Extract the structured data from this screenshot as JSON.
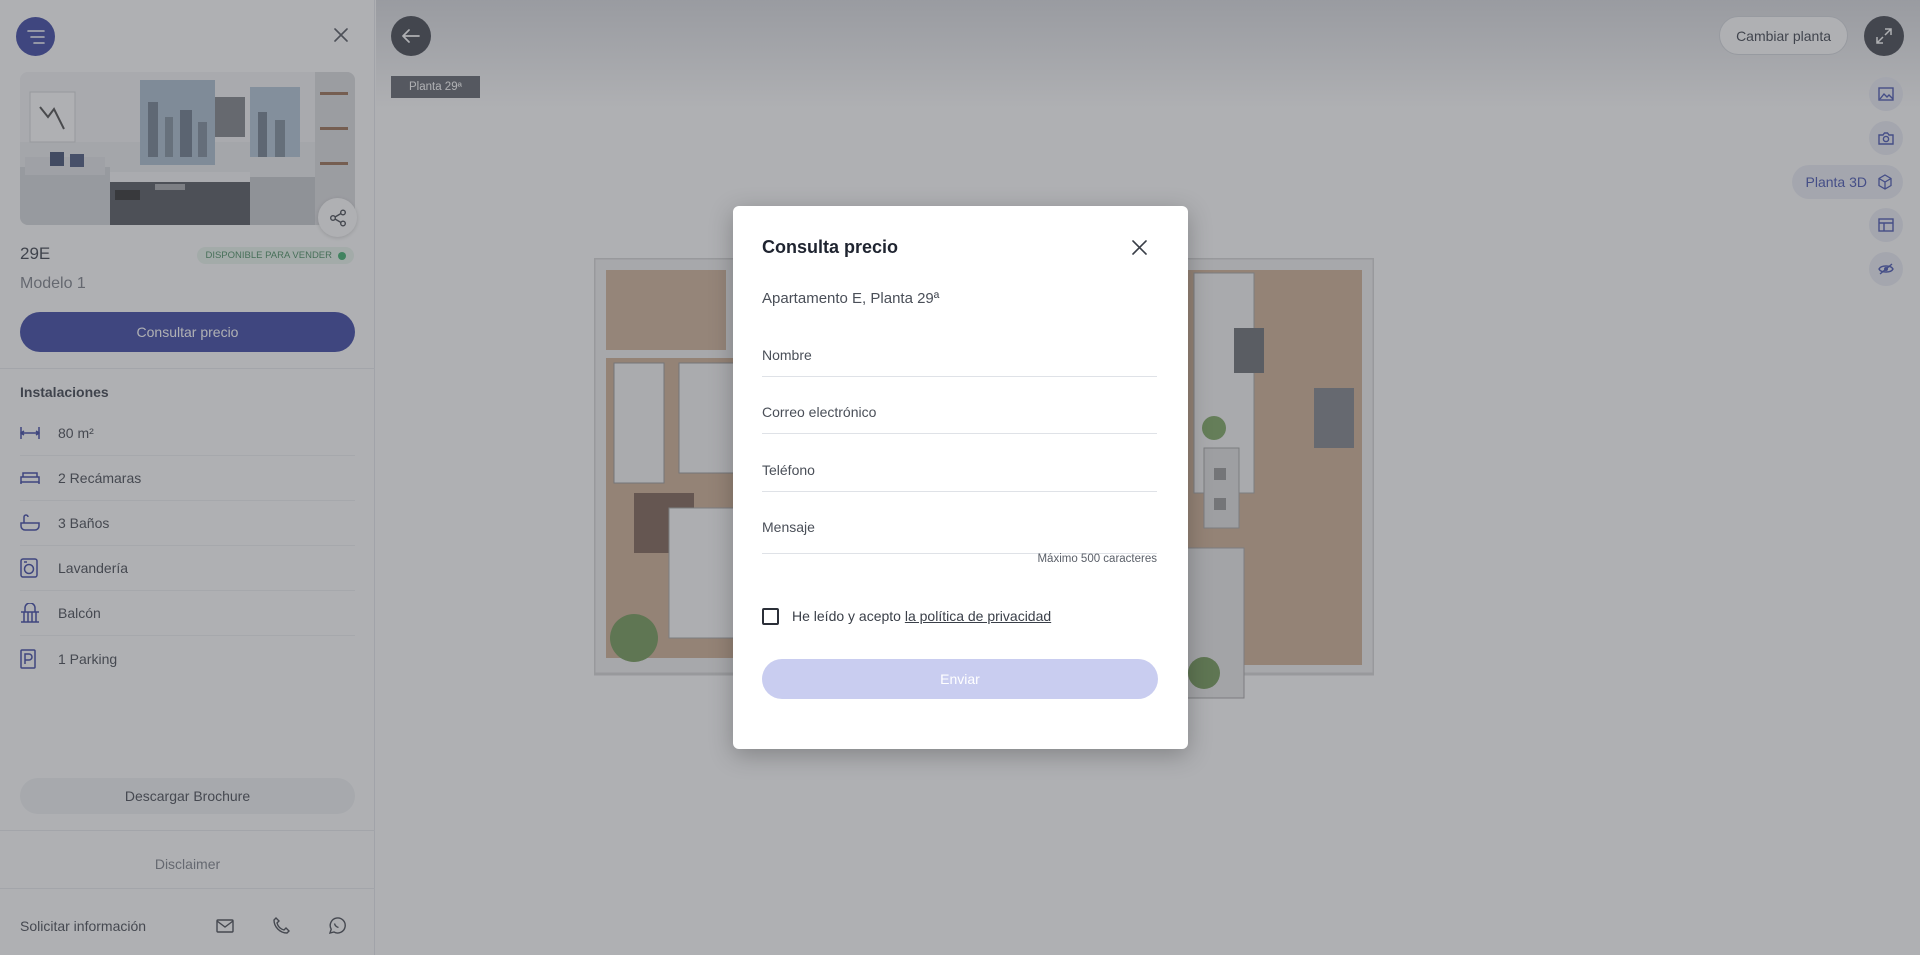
{
  "sidebar": {
    "unit_name": "29E",
    "status": "DISPONIBLE PARA VENDER",
    "model_name": "Modelo 1",
    "primary_button": "Consultar precio",
    "features_title": "Instalaciones",
    "features": [
      {
        "icon": "area-icon",
        "label": "80 m²"
      },
      {
        "icon": "bed-icon",
        "label": "2 Recámaras"
      },
      {
        "icon": "bath-icon",
        "label": "3 Baños"
      },
      {
        "icon": "laundry-icon",
        "label": "Lavandería"
      },
      {
        "icon": "balcony-icon",
        "label": "Balcón"
      },
      {
        "icon": "parking-icon",
        "label": "1 Parking"
      }
    ],
    "brochure_button": "Descargar Brochure",
    "disclaimer": "Disclaimer",
    "request_info": "Solicitar información"
  },
  "main": {
    "floor_tag": "Planta 29ª",
    "change_floor_button": "Cambiar planta",
    "view_3d_label": "Planta 3D"
  },
  "modal": {
    "title": "Consulta precio",
    "subtitle": "Apartamento E, Planta 29ª",
    "name_placeholder": "Nombre",
    "email_placeholder": "Correo electrónico",
    "phone_placeholder": "Teléfono",
    "message_placeholder": "Mensaje",
    "message_hint": "Máximo 500 caracteres",
    "consent_text": "He leído y acepto ",
    "consent_link": "la política de privacidad",
    "submit_button": "Enviar"
  },
  "colors": {
    "brand": "#1e2a96",
    "available": "#23a559",
    "submit_disabled": "#c9cdf0"
  }
}
